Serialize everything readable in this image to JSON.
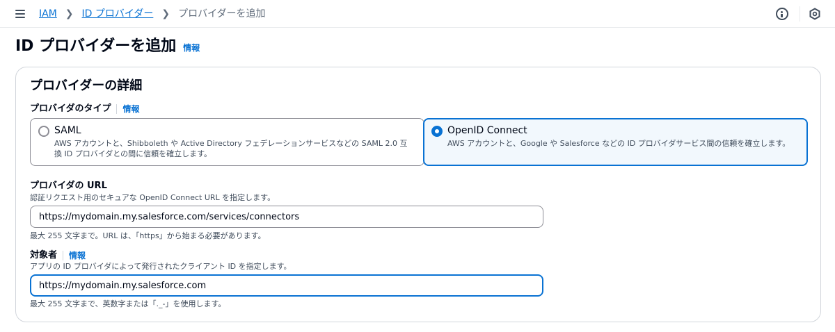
{
  "breadcrumb": {
    "items": [
      "IAM",
      "ID プロバイダー"
    ],
    "current": "プロバイダーを追加"
  },
  "icons": {
    "menu": "hamburger-menu-icon",
    "info": "info-circle-icon",
    "hex": "hexagon-icon",
    "separator": "chevron-right-icon"
  },
  "page": {
    "title": "ID プロバイダーを追加",
    "info": "情報"
  },
  "details": {
    "title": "プロバイダーの詳細",
    "type_label": "プロバイダのタイプ",
    "type_info": "情報",
    "options": [
      {
        "title": "SAML",
        "desc": "AWS アカウントと、Shibboleth や Active Directory フェデレーションサービスなどの SAML 2.0 互換 ID プロバイダとの間に信頼を確立します。",
        "selected": false
      },
      {
        "title": "OpenID Connect",
        "desc": "AWS アカウントと、Google や Salesforce などの ID プロバイダサービス間の信頼を確立します。",
        "selected": true
      }
    ],
    "url": {
      "label": "プロバイダの URL",
      "desc": "認証リクエスト用のセキュアな OpenID Connect URL を指定します。",
      "value": "https://mydomain.my.salesforce.com/services/connectors",
      "constraint": "最大 255 文字まで。URL は、「https」から始まる必要があります。"
    },
    "audience": {
      "label": "対象者",
      "info": "情報",
      "desc": "アプリの ID プロバイダによって発行されたクライアント ID を指定します。",
      "value": "https://mydomain.my.salesforce.com",
      "constraint": "最大 255 文字まで、英数字または「._-」を使用します。"
    }
  },
  "colors": {
    "accent": "#0972d3",
    "selected_bg": "#f2f8fd",
    "text": "#000716",
    "muted": "#414d5c"
  }
}
